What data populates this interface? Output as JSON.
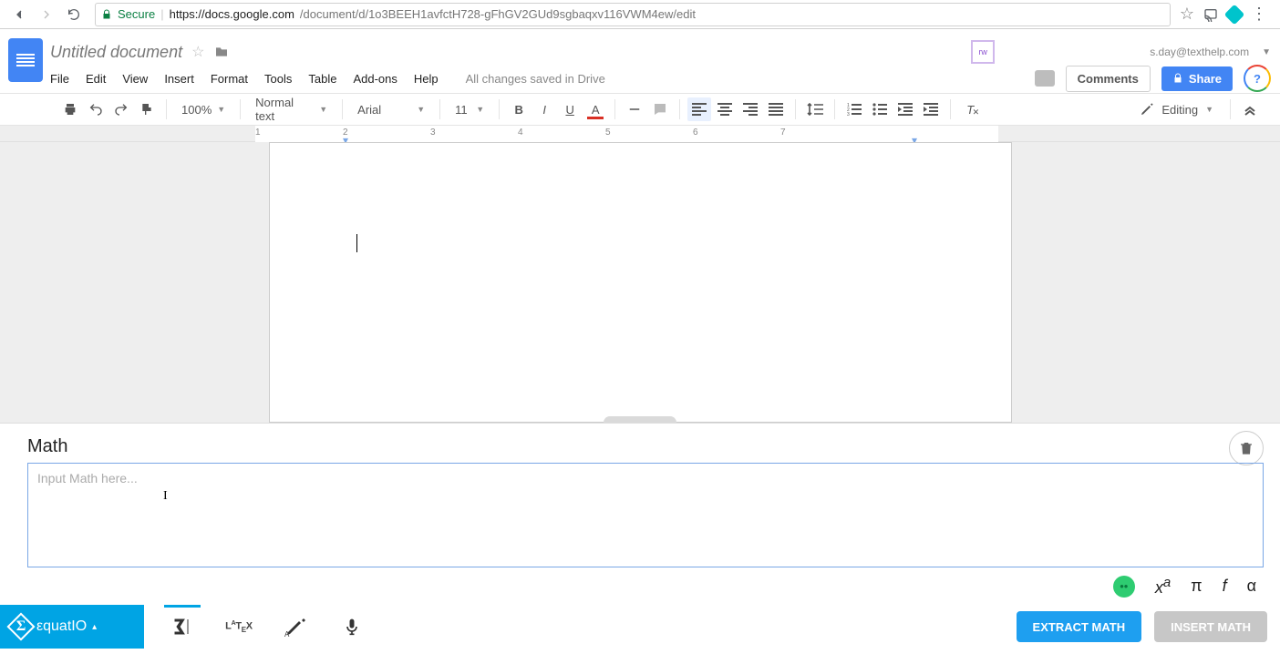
{
  "browser": {
    "secure_label": "Secure",
    "url_host": "https://docs.google.com",
    "url_path": "/document/d/1o3BEEH1avfctH728-gFhGV2GUd9sgbaqxv116VWM4ew/edit"
  },
  "header": {
    "doc_title": "Untitled document",
    "menus": [
      "File",
      "Edit",
      "View",
      "Insert",
      "Format",
      "Tools",
      "Table",
      "Add-ons",
      "Help"
    ],
    "save_status": "All changes saved in Drive",
    "user_email": "s.day@texthelp.com",
    "comments_label": "Comments",
    "share_label": "Share",
    "ext_badge": "rw"
  },
  "toolbar": {
    "zoom": "100%",
    "style": "Normal text",
    "font": "Arial",
    "size": "11",
    "mode": "Editing"
  },
  "ruler": {
    "ticks": [
      "1",
      "2",
      "3",
      "4",
      "5",
      "6",
      "7"
    ]
  },
  "equatio": {
    "title": "Math",
    "placeholder": "Input Math here...",
    "brand": "εquatIO",
    "latex_label": "LATEX",
    "extract_label": "EXTRACT MATH",
    "insert_label": "INSERT MATH",
    "symbols": {
      "xa": "x",
      "xa_sup": "a",
      "pi": "π",
      "f": "f",
      "alpha": "α"
    }
  }
}
